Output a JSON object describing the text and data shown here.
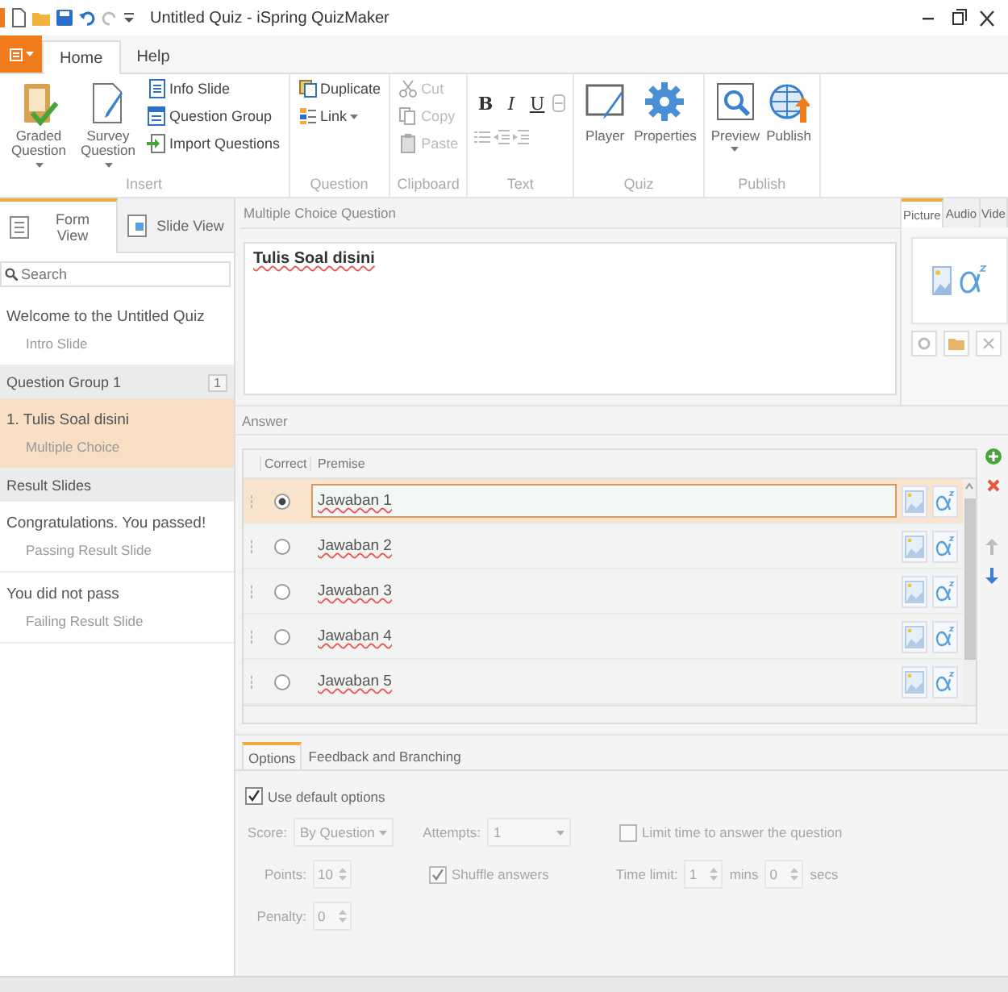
{
  "window": {
    "title": "Untitled Quiz - iSpring QuizMaker"
  },
  "ribbon_tabs": [
    {
      "label": "Home",
      "selected": true
    },
    {
      "label": "Help",
      "selected": false
    }
  ],
  "ribbon_groups": [
    {
      "label": "Insert",
      "items": [
        {
          "kind": "large",
          "label": "Graded Question",
          "menu": true,
          "disabled": false
        },
        {
          "kind": "large",
          "label": "Survey Question",
          "menu": true,
          "disabled": false
        },
        {
          "kind": "small",
          "label": "Info Slide",
          "disabled": false
        },
        {
          "kind": "small",
          "label": "Question Group",
          "disabled": false
        },
        {
          "kind": "small",
          "label": "Import Questions",
          "disabled": false
        }
      ]
    },
    {
      "label": "Question",
      "items": [
        {
          "kind": "small",
          "label": "Duplicate",
          "disabled": false
        },
        {
          "kind": "small",
          "label": "Link",
          "menu": true,
          "disabled": false
        }
      ]
    },
    {
      "label": "Clipboard",
      "items": [
        {
          "kind": "small",
          "label": "Cut",
          "disabled": true
        },
        {
          "kind": "small",
          "label": "Copy",
          "disabled": true
        },
        {
          "kind": "small",
          "label": "Paste",
          "disabled": true
        }
      ]
    },
    {
      "label": "Text",
      "items": [
        {
          "kind": "bold",
          "label": "B"
        },
        {
          "kind": "italic",
          "label": "I"
        },
        {
          "kind": "underline",
          "label": "U"
        }
      ]
    },
    {
      "label": "Quiz",
      "items": [
        {
          "kind": "large",
          "label": "Player",
          "disabled": false
        },
        {
          "kind": "large",
          "label": "Properties",
          "disabled": false
        }
      ]
    },
    {
      "label": "Publish",
      "items": [
        {
          "kind": "large",
          "label": "Preview",
          "menu": true,
          "disabled": false
        },
        {
          "kind": "large",
          "label": "Publish",
          "disabled": false
        }
      ]
    }
  ],
  "sidebar": {
    "tabs": [
      {
        "label": "Form View",
        "selected": true
      },
      {
        "label": "Slide View",
        "selected": false
      }
    ],
    "search": {
      "placeholder": "Search"
    },
    "items": [
      {
        "kind": "slide",
        "title": "Welcome to the Untitled Quiz",
        "subtitle": "Intro Slide",
        "selected": false
      },
      {
        "kind": "group",
        "title": "Question Group 1",
        "count": "1"
      },
      {
        "kind": "slide",
        "title": "1. Tulis Soal disini",
        "subtitle": "Multiple Choice",
        "selected": true
      },
      {
        "kind": "group",
        "title": "Result Slides"
      },
      {
        "kind": "slide",
        "title": "Congratulations. You passed!",
        "subtitle": "Passing Result Slide",
        "selected": false
      },
      {
        "kind": "slide",
        "title": "You did not pass",
        "subtitle": "Failing Result Slide",
        "selected": false
      }
    ]
  },
  "question": {
    "header": "Multiple Choice Question",
    "text": "Tulis Soal disini"
  },
  "media": {
    "tabs": [
      {
        "label": "Picture",
        "selected": true
      },
      {
        "label": "Audio",
        "selected": false
      },
      {
        "label": "Vide",
        "selected": false
      }
    ]
  },
  "answers": {
    "header": "Answer",
    "columns": [
      "Correct",
      "Premise"
    ],
    "rows": [
      {
        "text": "Jawaban 1",
        "correct": true,
        "selected": true
      },
      {
        "text": "Jawaban 2",
        "correct": false,
        "selected": false
      },
      {
        "text": "Jawaban 3",
        "correct": false,
        "selected": false
      },
      {
        "text": "Jawaban 4",
        "correct": false,
        "selected": false
      },
      {
        "text": "Jawaban 5",
        "correct": false,
        "selected": false
      }
    ]
  },
  "options": {
    "tabs": [
      {
        "label": "Options",
        "selected": true
      },
      {
        "label": "Feedback and Branching",
        "selected": false
      }
    ],
    "use_default": {
      "label": "Use default options",
      "checked": true
    },
    "disabled": true,
    "score": {
      "label": "Score:",
      "value": "By Question"
    },
    "attempts": {
      "label": "Attempts:",
      "value": "1"
    },
    "limit_time": {
      "label": "Limit time to answer the question",
      "checked": false
    },
    "points": {
      "label": "Points:",
      "value": "10"
    },
    "shuffle": {
      "label": "Shuffle answers",
      "checked": true
    },
    "time_limit": {
      "label": "Time limit:",
      "minutes": "1",
      "minutes_unit": "mins",
      "seconds": "0",
      "seconds_unit": "secs"
    },
    "penalty": {
      "label": "Penalty:",
      "value": "0"
    }
  }
}
